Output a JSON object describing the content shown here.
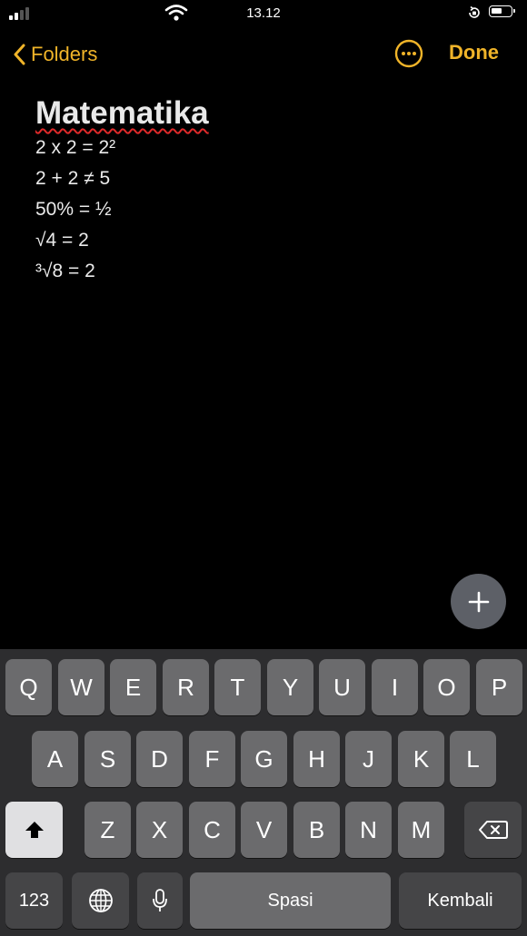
{
  "status_bar": {
    "time": "13.12"
  },
  "nav": {
    "back_label": "Folders",
    "done_label": "Done",
    "accent_color": "#f0b429"
  },
  "note": {
    "title": "Matematika",
    "lines": [
      "2 x 2 = 2²",
      "2 + 2 ≠ 5",
      "50% = ½",
      "√4 = 2",
      "³√8 = 2"
    ]
  },
  "keyboard": {
    "row1": [
      "Q",
      "W",
      "E",
      "R",
      "T",
      "Y",
      "U",
      "I",
      "O",
      "P"
    ],
    "row2": [
      "A",
      "S",
      "D",
      "F",
      "G",
      "H",
      "J",
      "K",
      "L"
    ],
    "row3": [
      "Z",
      "X",
      "C",
      "V",
      "B",
      "N",
      "M"
    ],
    "numbers_label": "123",
    "space_label": "Spasi",
    "return_label": "Kembali"
  }
}
